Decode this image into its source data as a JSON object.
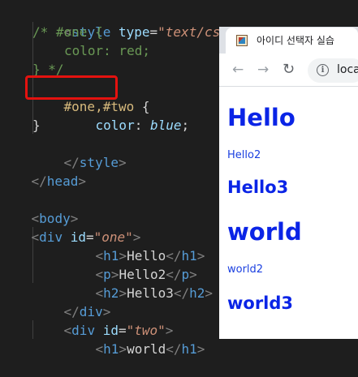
{
  "editor": {
    "lines": {
      "l1": {
        "open": "<",
        "name": "style",
        "attr": "type",
        "eq": "=",
        "val": "\"text/css\"",
        "close": ">"
      },
      "l2": "/* #one {",
      "l3": "color: red;",
      "l4": "} */",
      "l5": {
        "selector": "#one,#two",
        "brace": " {"
      },
      "l6": {
        "prop": "color",
        "colon": ": ",
        "value": "blue",
        "semi": ";"
      },
      "l7": "}",
      "l8": {
        "open": "</",
        "name": "style",
        "close": ">"
      },
      "l9": {
        "open": "</",
        "name": "head",
        "close": ">"
      },
      "l11": {
        "open": "<",
        "name": "body",
        "close": ">"
      },
      "l12": {
        "open": "<",
        "name": "div",
        "attr": "id",
        "eq": "=",
        "val": "\"one\"",
        "close": ">"
      },
      "l13": {
        "o1": "<",
        "name": "h1",
        "c1": ">",
        "text": "Hello",
        "o2": "</",
        "name2": "h1",
        "c2": ">"
      },
      "l14": {
        "o1": "<",
        "name": "p",
        "c1": ">",
        "text": "Hello2",
        "o2": "</",
        "name2": "p",
        "c2": ">"
      },
      "l15": {
        "o1": "<",
        "name": "h2",
        "c1": ">",
        "text": "Hello3",
        "o2": "</",
        "name2": "h2",
        "c2": ">"
      },
      "l16": {
        "open": "</",
        "name": "div",
        "close": ">"
      },
      "l17": {
        "open": "<",
        "name": "div",
        "attr": "id",
        "eq": "=",
        "val": "\"two\"",
        "close": ">"
      },
      "l18": {
        "o1": "<",
        "name": "h1",
        "c1": ">",
        "text": "world",
        "o2": "</",
        "name2": "h1",
        "c2": ">"
      }
    }
  },
  "browser": {
    "tab_title": "아이디 선택자 실습",
    "url_text": "loca",
    "icons": {
      "back": "arrow-left",
      "forward": "arrow-right",
      "reload": "reload",
      "info": "info-circle"
    },
    "content": {
      "h1_one": "Hello",
      "p_one": "Hello2",
      "h2_one": "Hello3",
      "h1_two": "world",
      "p_two": "world2",
      "h2_two": "world3"
    }
  },
  "colors": {
    "highlight_box": "#e4120f",
    "rendered_text": "#0a24e6",
    "editor_bg": "#1e1e1e"
  }
}
